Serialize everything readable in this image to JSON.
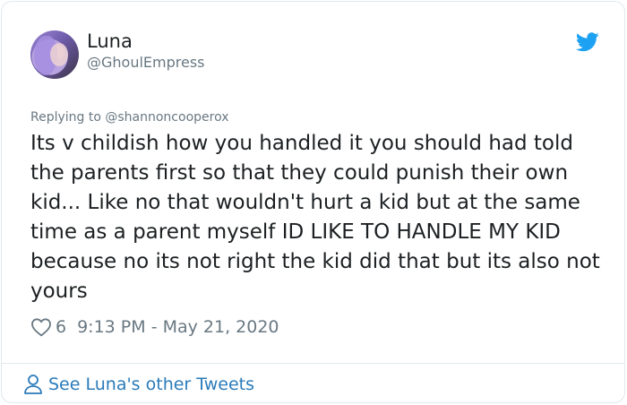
{
  "user": {
    "display_name": "Luna",
    "handle": "@GhoulEmpress"
  },
  "reply": {
    "replying_to": "Replying to @shannoncooperox"
  },
  "tweet": {
    "text": "Its v childish how you handled it you should had told the parents first so that they could punish their own kid... Like no that wouldn't hurt a kid but at the same time as a parent myself ID LIKE TO HANDLE MY KID because no its not right the kid did that but its also not yours",
    "likes": "6",
    "timestamp": "9:13 PM - May 21, 2020"
  },
  "footer": {
    "link_label": "See Luna's other Tweets"
  },
  "icons": {
    "brand": "twitter-bird-icon",
    "like": "heart-icon",
    "profile": "person-icon"
  },
  "colors": {
    "twitter_blue": "#1da1f2",
    "link_blue": "#2b7bb9",
    "muted_text": "#697882",
    "body_text": "#1c2022",
    "border": "#e1e8ed"
  }
}
